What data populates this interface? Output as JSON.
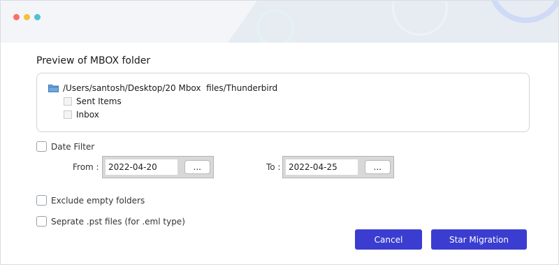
{
  "window": {
    "controls": [
      "close",
      "minimize",
      "zoom"
    ]
  },
  "preview": {
    "heading": "Preview of MBOX folder",
    "root_path": "/Users/santosh/Desktop/20 Mbox  files/Thunderbird",
    "items": [
      "Sent Items",
      "Inbox"
    ]
  },
  "date_filter": {
    "label": "Date Filter",
    "checked": false,
    "from_label": "From :",
    "from_value": "2022-04-20",
    "to_label": "To :",
    "to_value": "2022-04-25",
    "browse_label": "..."
  },
  "options": {
    "exclude_empty": "Exclude empty folders",
    "separate_pst": "Seprate .pst files (for .eml type)"
  },
  "buttons": {
    "cancel": "Cancel",
    "start": "Star Migration"
  },
  "colors": {
    "accent": "#3b3dd1",
    "close": "#ff6b6b",
    "minimize": "#f7bf3c",
    "zoom": "#4fc1d4"
  }
}
